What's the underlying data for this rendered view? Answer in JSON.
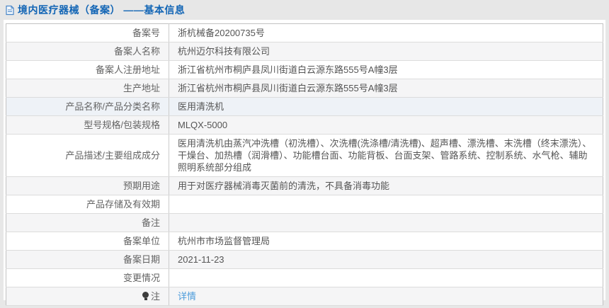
{
  "header": {
    "title": "境内医疗器械（备案） ——基本信息"
  },
  "colors": {
    "title_blue": "#1265b5",
    "link_blue": "#4d9cdb",
    "stripe_gray": "#f5f5f6",
    "highlight_row": "#eef2f7",
    "page_background": "#e7e7e7"
  },
  "table": {
    "rows": [
      {
        "label": "备案号",
        "value": "浙杭械备20200735号"
      },
      {
        "label": "备案人名称",
        "value": "杭州迈尔科技有限公司"
      },
      {
        "label": "备案人注册地址",
        "value": "浙江省杭州市桐庐县凤川街道白云源东路555号A幢3层"
      },
      {
        "label": "生产地址",
        "value": "浙江省杭州市桐庐县凤川街道白云源东路555号A幢3层"
      },
      {
        "label": "产品名称/产品分类名称",
        "value": "医用清洗机",
        "highlight": true
      },
      {
        "label": "型号规格/包装规格",
        "value": "MLQX-5000"
      },
      {
        "label": "产品描述/主要组成成分",
        "value": "医用清洗机由蒸汽冲洗槽（初洗槽）、次洗槽(洗涤槽/清洗槽)、超声槽、漂洗槽、末洗槽（终末漂洗）、干燥台、加热槽（润滑槽）、功能槽台面、功能背板、台面支架、管路系统、控制系统、水气枪、辅助照明系统部分组成"
      },
      {
        "label": "预期用途",
        "value": "用于对医疗器械消毒灭菌前的清洗，不具备消毒功能"
      },
      {
        "label": "产品存储及有效期",
        "value": ""
      },
      {
        "label": "备注",
        "value": ""
      },
      {
        "label": "备案单位",
        "value": "杭州市市场监督管理局"
      },
      {
        "label": "备案日期",
        "value": "2021-11-23"
      },
      {
        "label": "变更情况",
        "value": ""
      },
      {
        "label": "注",
        "label_icon": "bulb-icon",
        "value": "详情",
        "value_is_link": true
      }
    ]
  }
}
